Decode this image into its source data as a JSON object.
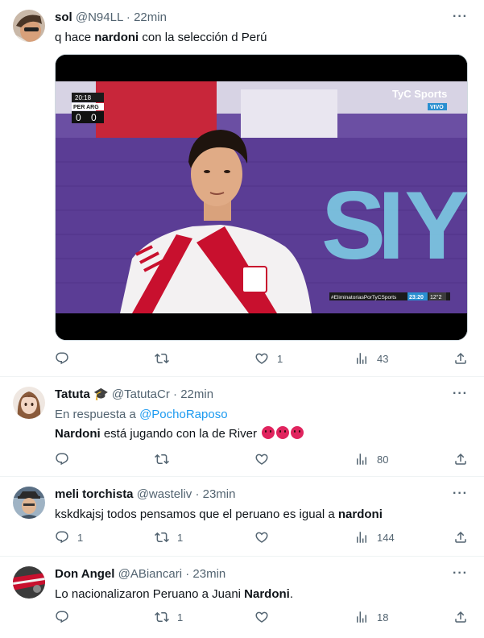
{
  "tweets": [
    {
      "name": "sol",
      "handle": "@N94LL",
      "sep": "·",
      "time": "22min",
      "text_pre": "q hace ",
      "text_bold": "nardoni",
      "text_post": " con la selección d Perú",
      "media": {
        "score_time": "20:18",
        "team1": "PER",
        "team2": "ARG",
        "score1": "0",
        "score2": "0",
        "brand": "TyC Sports",
        "live": "VIVO",
        "hashtag": "#EliminatoriasPorTyCSports",
        "clock": "23:20",
        "temp": "12°2"
      },
      "replies": "",
      "retweets": "",
      "likes": "1",
      "views": "43"
    },
    {
      "name": "Tatuta",
      "badge": "🎓",
      "handle": "@TatutaCr",
      "sep": "·",
      "time": "22min",
      "reply_label": "En respuesta a ",
      "reply_handle": "@PochoRaposo",
      "text_bold": "Nardoni",
      "text_post": " está jugando con la de River",
      "replies": "",
      "retweets": "",
      "likes": "",
      "views": "80"
    },
    {
      "name": "meli torchista",
      "handle": "@wasteliv",
      "sep": "·",
      "time": "23min",
      "text_pre": "kskdkajsj todos pensamos que el peruano es igual a ",
      "text_bold": "nardoni",
      "replies": "1",
      "retweets": "1",
      "likes": "",
      "views": "144"
    },
    {
      "name": "Don Angel",
      "handle": "@ABiancari",
      "sep": "·",
      "time": "23min",
      "text_pre": "Lo nacionalizaron Peruano a Juani ",
      "text_bold": "Nardoni",
      "text_post": ".",
      "replies": "",
      "retweets": "1",
      "likes": "",
      "views": "18"
    }
  ],
  "more_label": "···",
  "colors": {
    "accent": "#1d9bf0",
    "muted": "#536471",
    "text": "#0f1419"
  }
}
